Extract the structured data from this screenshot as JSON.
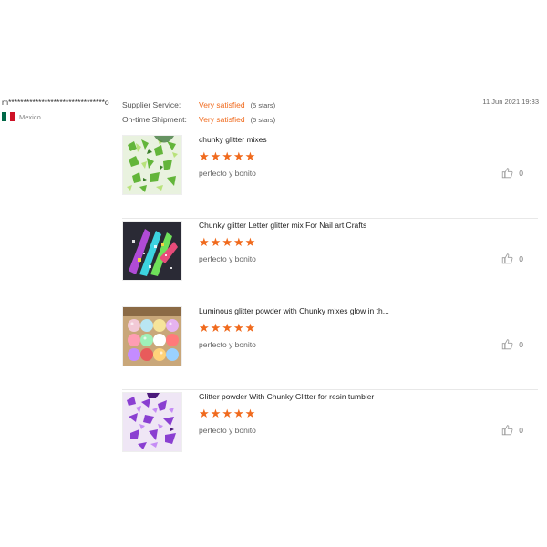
{
  "reviewer": {
    "name": "m********************************o",
    "country": "Mexico",
    "flag_colors": [
      "#006847",
      "#ffffff",
      "#ce1126"
    ]
  },
  "ratings": [
    {
      "label": "Supplier Service:",
      "value": "Very satisfied",
      "stars": "(5 stars)"
    },
    {
      "label": "On-time Shipment:",
      "value": "Very satisfied",
      "stars": "(5 stars)"
    }
  ],
  "review_date": "11 Jun 2021 19:33",
  "colors": {
    "accent": "#f06a1d"
  },
  "items": [
    {
      "title": "chunky glitter mixes",
      "rating": 5,
      "comment": "perfecto y bonito",
      "likes": "0",
      "thumb": "green-glitter"
    },
    {
      "title": "Chunky glitter Letter glitter mix For Nail art Crafts",
      "rating": 5,
      "comment": "perfecto y bonito",
      "likes": "0",
      "thumb": "rainbow-glitter-letters"
    },
    {
      "title": "Luminous glitter powder with Chunky mixes glow in th...",
      "rating": 5,
      "comment": "perfecto y bonito",
      "likes": "0",
      "thumb": "glitter-jars"
    },
    {
      "title": "Glitter powder With Chunky Glitter for resin tumbler",
      "rating": 5,
      "comment": "perfecto y bonito",
      "likes": "0",
      "thumb": "purple-glitter"
    }
  ]
}
